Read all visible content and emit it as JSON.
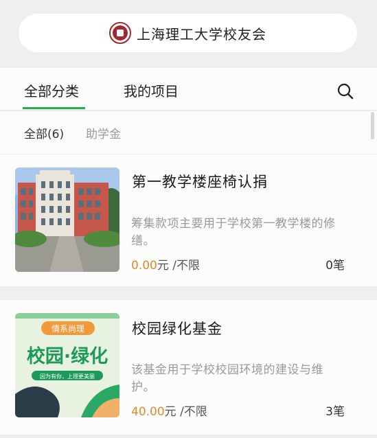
{
  "header": {
    "title": "上海理工大学校友会",
    "logo_icon": "university-seal-icon",
    "brand_color": "#a3282e"
  },
  "tabs": [
    {
      "label": "全部分类",
      "active": true
    },
    {
      "label": "我的项目",
      "active": false
    }
  ],
  "accent_color": "#22b14c",
  "search_icon": "search-icon",
  "filters": [
    {
      "label": "全部(6)",
      "active": true
    },
    {
      "label": "助学金",
      "active": false
    }
  ],
  "projects": [
    {
      "title": "第一教学楼座椅认捐",
      "description": "筹集款项主要用于学校第一教学楼的修缮。",
      "amount": "0.00",
      "price_suffix": "元 /不限",
      "count": "0笔",
      "image": "building-photo"
    },
    {
      "title": "校园绿化基金",
      "description": "该基金用于学校校园环境的建设与维护。",
      "amount": "40.00",
      "price_suffix": "元 /不限",
      "count": "3笔",
      "image": "greening-poster",
      "poster": {
        "tag": "情系尚理",
        "headline": "校园·绿化",
        "slogan": "因为有你，上理更美丽"
      }
    }
  ],
  "amount_color": "#e08a2b"
}
